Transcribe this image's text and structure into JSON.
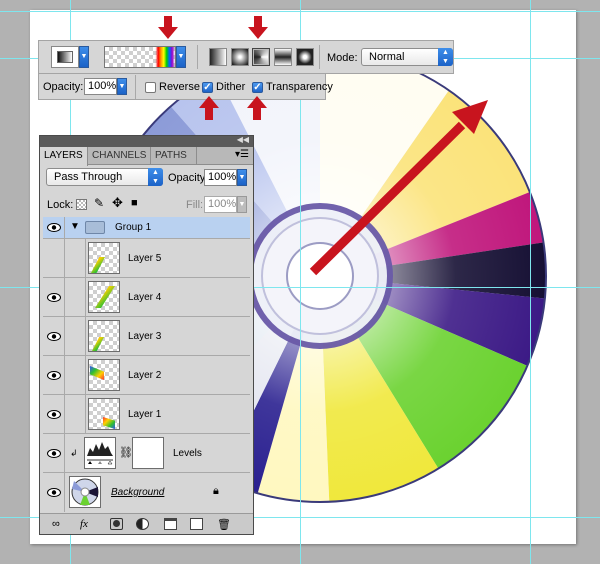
{
  "toolbar": {
    "mode_label": "Mode:",
    "mode_value": "Normal",
    "opacity_label": "Opacity:",
    "opacity_value": "100%",
    "reverse_label": "Reverse",
    "reverse_checked": false,
    "dither_label": "Dither",
    "dither_checked": true,
    "transparency_label": "Transparency",
    "transparency_checked": true,
    "gradient_types": [
      "linear-gradient",
      "radial-gradient",
      "angle-gradient",
      "reflected-gradient",
      "diamond-gradient"
    ],
    "active_gradient_type": "angle-gradient"
  },
  "layers_panel": {
    "tabs": [
      "LAYERS",
      "CHANNELS",
      "PATHS"
    ],
    "active_tab": "LAYERS",
    "blend_mode": "Pass Through",
    "opacity_label": "Opacity:",
    "opacity_value": "100%",
    "lock_label": "Lock:",
    "fill_label": "Fill:",
    "fill_value": "100%",
    "group": {
      "name": "Group 1",
      "expanded": true
    },
    "layers": [
      {
        "name": "Layer 5"
      },
      {
        "name": "Layer 4"
      },
      {
        "name": "Layer 3"
      },
      {
        "name": "Layer 2"
      },
      {
        "name": "Layer 1"
      }
    ],
    "adjustment": {
      "name": "Levels"
    },
    "background": {
      "name": "Background",
      "locked": true
    },
    "bottom_icons": [
      "link-icon",
      "fx-icon",
      "mask-icon",
      "adjustment-icon",
      "folder-icon",
      "new-layer-icon",
      "trash-icon"
    ]
  },
  "colors": {
    "annotation_arrow": "#c8141e",
    "guide": "#7ee6ee",
    "selected_row": "#b9d1f0",
    "accent_blue": "#1b62c7"
  }
}
